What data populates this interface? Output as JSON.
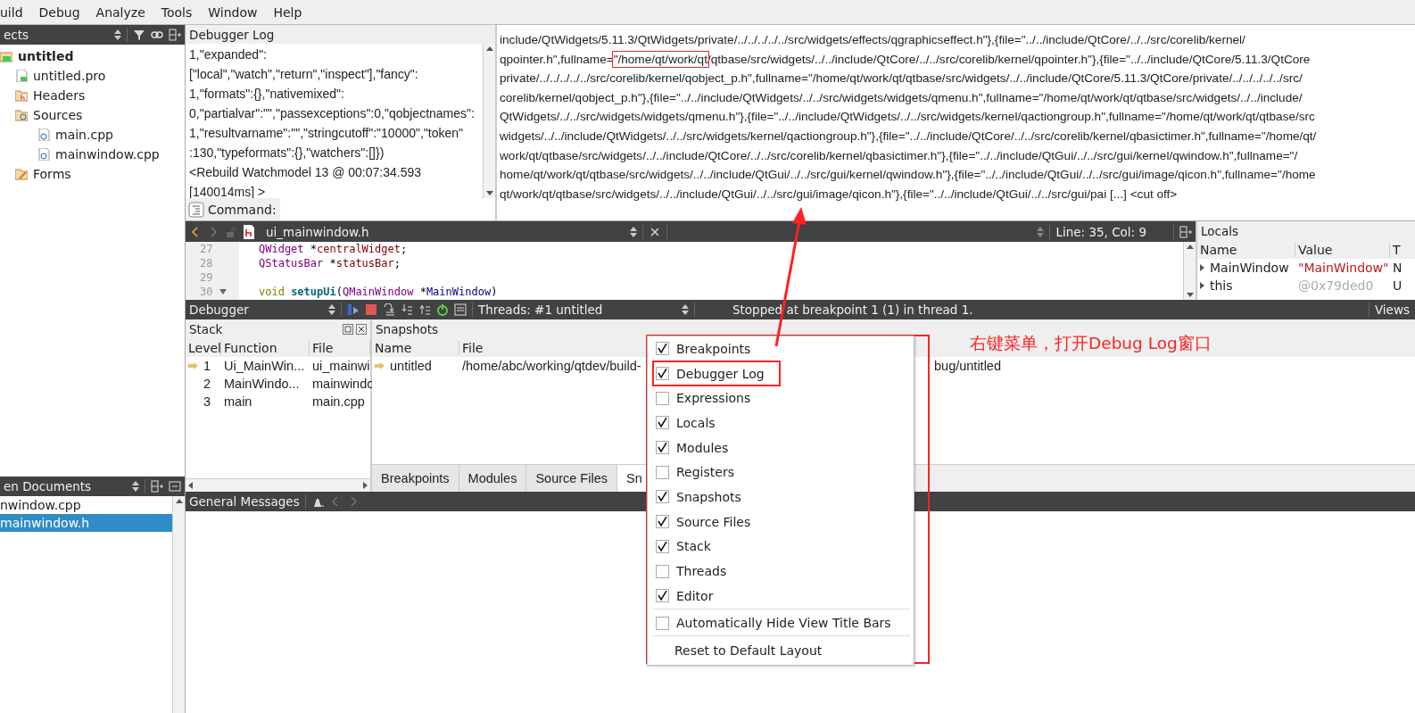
{
  "menu_bar": [
    "uild",
    "Debug",
    "Analyze",
    "Tools",
    "Window",
    "Help"
  ],
  "projects": {
    "title": "ects",
    "tree": [
      {
        "label": "untitled",
        "kind": "project",
        "children": [
          {
            "label": "untitled.pro",
            "kind": "pro"
          },
          {
            "label": "Headers",
            "kind": "folder-h"
          },
          {
            "label": "Sources",
            "kind": "folder-cpp",
            "children": [
              {
                "label": "main.cpp",
                "kind": "cpp"
              },
              {
                "label": "mainwindow.cpp",
                "kind": "cpp"
              }
            ]
          },
          {
            "label": "Forms",
            "kind": "folder-form"
          }
        ]
      }
    ]
  },
  "open_documents": {
    "title": "en Documents",
    "items": [
      {
        "label": "nwindow.cpp",
        "selected": false
      },
      {
        "label": "mainwindow.h",
        "selected": true
      }
    ]
  },
  "debugger_log": {
    "title": "Debugger Log",
    "lines": [
      "1,\"expanded\":",
      "[\"local\",\"watch\",\"return\",\"inspect\"],\"fancy\":",
      "1,\"formats\":{},\"nativemixed\":",
      "0,\"partialvar\":\"\",\"passexceptions\":0,\"qobjectnames\":",
      "1,\"resultvarname\":\"\",\"stringcutoff\":\"10000\",\"token\"",
      ":130,\"typeformats\":{},\"watchers\":[]})",
      "<Rebuild Watchmodel 13 @ 00:07:34.593",
      "[140014ms] >"
    ],
    "command_label": "Command:"
  },
  "log_output": {
    "lines": [
      {
        "text": "include/QtWidgets/5.11.3/QtWidgets/private/../../../../../src/widgets/effects/qgraphicseffect.h\"},{file=\"../../include/QtCore/../../src/corelib/kernel/"
      },
      {
        "text": "qpointer.h\",fullname=",
        "boxed": "\"/home/qt/work/qt",
        "rest": "/qtbase/src/widgets/../../include/QtCore/../../src/corelib/kernel/qpointer.h\"},{file=\"../../include/QtCore/5.11.3/QtCore"
      },
      {
        "text": "private/../../../../../src/corelib/kernel/qobject_p.h\",fullname=\"/home/qt/work/qt/qtbase/src/widgets/../../include/QtCore/5.11.3/QtCore/private/../../../../../src/"
      },
      {
        "text": "corelib/kernel/qobject_p.h\"},{file=\"../../include/QtWidgets/../../src/widgets/widgets/qmenu.h\",fullname=\"/home/qt/work/qt/qtbase/src/widgets/../../include/"
      },
      {
        "text": "QtWidgets/../../src/widgets/widgets/qmenu.h\"},{file=\"../../include/QtWidgets/../../src/widgets/kernel/qactiongroup.h\",fullname=\"/home/qt/work/qt/qtbase/src"
      },
      {
        "text": "widgets/../../include/QtWidgets/../../src/widgets/kernel/qactiongroup.h\"},{file=\"../../include/QtCore/../../src/corelib/kernel/qbasictimer.h\",fullname=\"/home/qt/"
      },
      {
        "text": "work/qt/qtbase/src/widgets/../../include/QtCore/../../src/corelib/kernel/qbasictimer.h\"},{file=\"../../include/QtGui/../../src/gui/kernel/qwindow.h\",fullname=\"/"
      },
      {
        "text": "home/qt/work/qt/qtbase/src/widgets/../../include/QtGui/../../src/gui/kernel/qwindow.h\"},{file=\"../../include/QtGui/../../src/gui/image/qicon.h\",fullname=\"/home"
      },
      {
        "text": "qt/work/qt/qtbase/src/widgets/../../include/QtGui/../../src/gui/image/qicon.h\"},{file=\"../../include/QtGui/../../src/gui/pai [...] <cut off>"
      }
    ]
  },
  "editor": {
    "file": "ui_mainwindow.h",
    "position": "Line: 35, Col: 9",
    "lines": [
      {
        "number": "27",
        "foldable": false,
        "tokens": [
          {
            "kind": "type",
            "text": "QWidget"
          },
          {
            "kind": "plain",
            "text": " *"
          },
          {
            "kind": "member",
            "text": "centralWidget"
          },
          {
            "kind": "plain",
            "text": ";"
          }
        ]
      },
      {
        "number": "28",
        "foldable": false,
        "tokens": [
          {
            "kind": "type",
            "text": "QStatusBar"
          },
          {
            "kind": "plain",
            "text": " *"
          },
          {
            "kind": "member",
            "text": "statusBar"
          },
          {
            "kind": "plain",
            "text": ";"
          }
        ]
      },
      {
        "number": "29",
        "foldable": false
      },
      {
        "number": "30",
        "foldable": true,
        "tokens": [
          {
            "kind": "keyword",
            "text": "void"
          },
          {
            "kind": "function",
            "text": " setupUi"
          },
          {
            "kind": "plain",
            "text": "("
          },
          {
            "kind": "type",
            "text": "QMainWindow"
          },
          {
            "kind": "plain",
            "text": " *"
          },
          {
            "kind": "param",
            "text": "MainWindow"
          },
          {
            "kind": "plain",
            "text": ")"
          }
        ]
      }
    ]
  },
  "locals": {
    "title": "Locals",
    "columns": [
      "Name",
      "Value",
      "T"
    ],
    "rows": [
      {
        "name": "MainWindow",
        "value": "\"MainWindow\"",
        "type": "N"
      },
      {
        "name": "this",
        "value": "@0x79ded0",
        "type": "U"
      }
    ]
  },
  "debugger_bar": {
    "title": "Debugger",
    "threads": "Threads: #1 untitled",
    "status": "Stopped at breakpoint 1 (1) in thread 1.",
    "views": "Views"
  },
  "stack": {
    "title": "Stack",
    "columns": [
      "Level",
      "Function",
      "File"
    ],
    "rows": [
      {
        "level": "1",
        "function": "Ui_MainWin...",
        "file": "ui_mainwi",
        "current": true
      },
      {
        "level": "2",
        "function": "MainWindo...",
        "file": "mainwindo",
        "current": false
      },
      {
        "level": "3",
        "function": "main",
        "file": "main.cpp",
        "current": false
      }
    ]
  },
  "snapshots": {
    "title": "Snapshots",
    "columns": [
      "Name",
      "File"
    ],
    "rows": [
      {
        "name": "untitled",
        "file": "/home/abc/working/qtdev/build-",
        "file_tail": "bug/untitled",
        "current": true
      }
    ]
  },
  "tabs": [
    {
      "label": "Breakpoints",
      "selected": false
    },
    {
      "label": "Modules",
      "selected": false
    },
    {
      "label": "Source Files",
      "selected": false
    },
    {
      "label": "Sn",
      "selected": true
    }
  ],
  "general_messages": {
    "title": "General Messages"
  },
  "context_menu": {
    "items": [
      {
        "kind": "check",
        "label": "Breakpoints",
        "checked": true,
        "marked": false
      },
      {
        "kind": "check",
        "label": "Debugger Log",
        "checked": true,
        "marked": true
      },
      {
        "kind": "check",
        "label": "Expressions",
        "checked": false,
        "marked": false
      },
      {
        "kind": "check",
        "label": "Locals",
        "checked": true,
        "marked": false
      },
      {
        "kind": "check",
        "label": "Modules",
        "checked": true,
        "marked": false
      },
      {
        "kind": "check",
        "label": "Registers",
        "checked": false,
        "marked": false
      },
      {
        "kind": "check",
        "label": "Snapshots",
        "checked": true,
        "marked": false
      },
      {
        "kind": "check",
        "label": "Source Files",
        "checked": true,
        "marked": false
      },
      {
        "kind": "check",
        "label": "Stack",
        "checked": true,
        "marked": false
      },
      {
        "kind": "check",
        "label": "Threads",
        "checked": false,
        "marked": false
      },
      {
        "kind": "check",
        "label": "Editor",
        "checked": true,
        "marked": false
      },
      {
        "kind": "separator"
      },
      {
        "kind": "check",
        "label": "Automatically Hide View Title Bars",
        "checked": false,
        "marked": false
      },
      {
        "kind": "separator"
      },
      {
        "kind": "action",
        "label": "Reset to Default Layout"
      }
    ]
  },
  "annotation": {
    "text": "右键菜单，打开Debug Log窗口"
  }
}
